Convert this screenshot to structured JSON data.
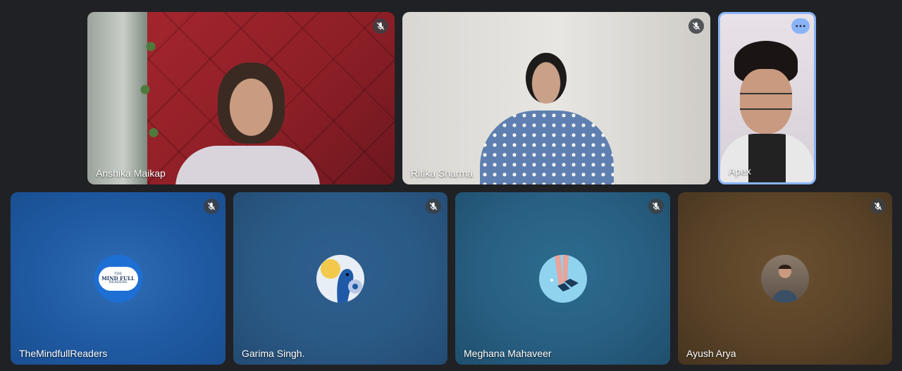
{
  "participants": [
    {
      "name": "Anshika Maikap",
      "muted": true,
      "video": true
    },
    {
      "name": "Ritika Sharma",
      "muted": true,
      "video": true
    },
    {
      "name": "Apex",
      "muted": false,
      "video": true,
      "speaking": true
    },
    {
      "name": "TheMindfullReaders",
      "muted": true,
      "video": false,
      "avatar_text": [
        "THE",
        "MIND FULL",
        "READERS"
      ]
    },
    {
      "name": "Garima Singh.",
      "muted": true,
      "video": false
    },
    {
      "name": "Meghana Mahaveer",
      "muted": true,
      "video": false
    },
    {
      "name": "Ayush Arya",
      "muted": true,
      "video": false
    }
  ],
  "colors": {
    "background": "#202124",
    "speaking_outline": "#8ab4f8",
    "mute_badge": "#3c4043"
  },
  "icons": {
    "mute": "mic-off-icon",
    "more": "more-options-icon"
  }
}
